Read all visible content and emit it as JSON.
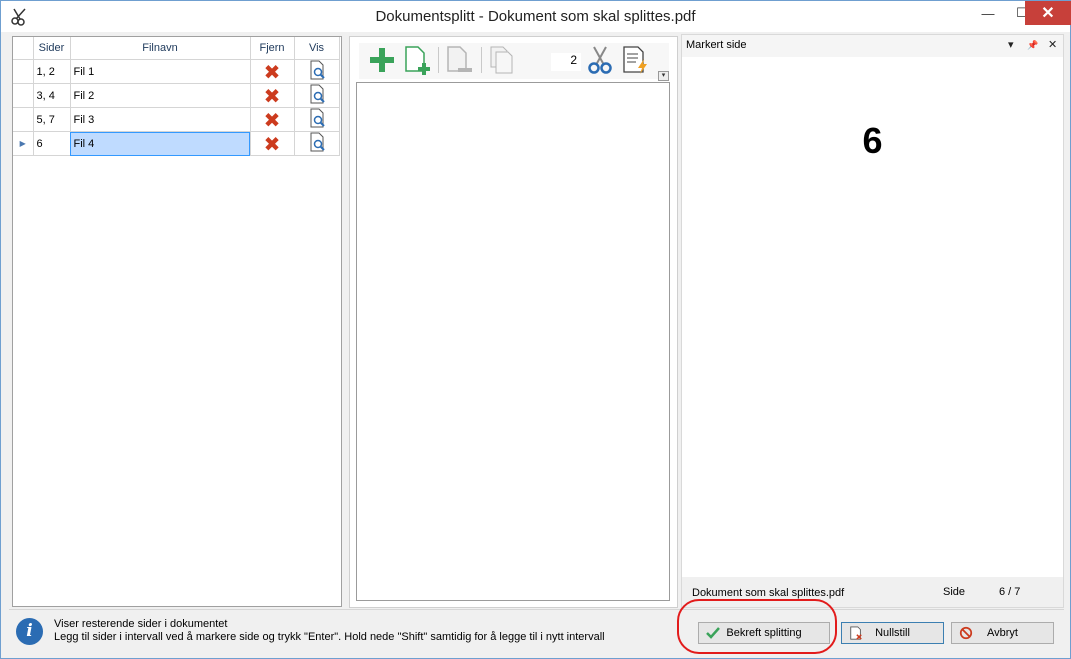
{
  "window": {
    "title": "Dokumentsplitt - Dokument som skal splittes.pdf",
    "icon": "scissors-icon",
    "controls": {
      "minimize": "—",
      "maximize": "☐",
      "close": "✕"
    }
  },
  "grid": {
    "headers": {
      "sider": "Sider",
      "filnavn": "Filnavn",
      "fjern": "Fjern",
      "vis": "Vis"
    },
    "rows": [
      {
        "sider": "1, 2",
        "filnavn": "Fil 1",
        "indicator": ""
      },
      {
        "sider": "3, 4",
        "filnavn": "Fil 2",
        "indicator": ""
      },
      {
        "sider": "5, 7",
        "filnavn": "Fil 3",
        "indicator": ""
      },
      {
        "sider": "6",
        "filnavn": "Fil 4",
        "indicator": "▶"
      }
    ],
    "remove_glyph": "✖",
    "remove_icon": "remove-x-icon",
    "view_icon": "document-preview-icon"
  },
  "toolbar": {
    "buttons": [
      "add-icon",
      "add-document-icon",
      "remove-page-icon",
      "copy-pages-icon",
      "scissors-icon",
      "auto-split-icon"
    ],
    "count_value": "2",
    "overflow_glyph": "▾"
  },
  "preview": {
    "header_title": "Markert side",
    "menu_glyph": "▾",
    "pin_glyph": "📌",
    "close_glyph": "✕",
    "page_number": "6",
    "document_name": "Dokument som skal splittes.pdf",
    "side_label": "Side",
    "side_value": "6  / 7"
  },
  "status": {
    "info_glyph": "i",
    "line1": "Viser resterende sider i dokumentet",
    "line2": "Legg til sider i intervall ved å markere side og trykk \"Enter\". Hold nede \"Shift\" samtidig for å legge til i nytt intervall"
  },
  "buttons": {
    "confirm": "Bekreft splitting",
    "reset": "Nullstill",
    "cancel": "Avbryt"
  },
  "colors": {
    "accent_highlight": "#e21b1b",
    "selection": "#bfdbff",
    "remove": "#cc3b1e",
    "add": "#3aa35a",
    "info": "#2b6cb3"
  }
}
